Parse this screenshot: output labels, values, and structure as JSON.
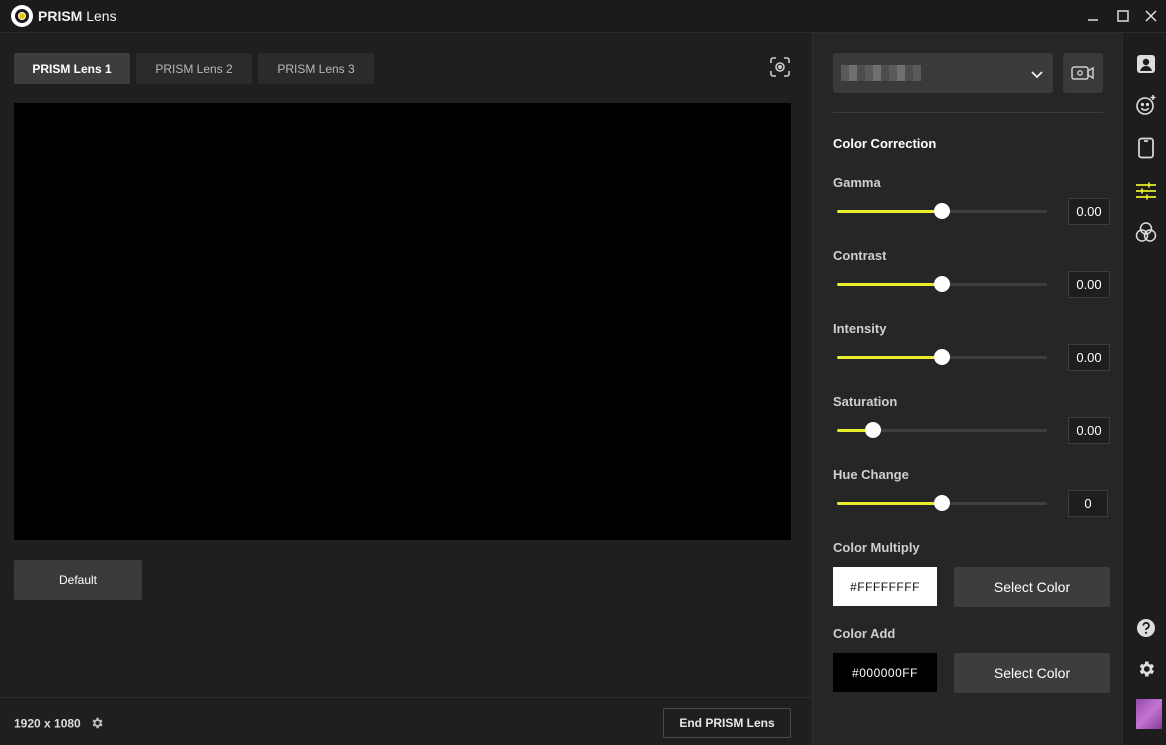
{
  "window": {
    "title_bold": "PRISM",
    "title_light": "Lens"
  },
  "tabs": [
    {
      "label": "PRISM Lens 1",
      "active": true
    },
    {
      "label": "PRISM Lens 2",
      "active": false
    },
    {
      "label": "PRISM Lens 3",
      "active": false
    }
  ],
  "preview": {
    "default_label": "Default"
  },
  "footer": {
    "resolution": "1920 x 1080",
    "end_label": "End PRISM Lens"
  },
  "panel": {
    "section_title": "Color Correction",
    "sliders": [
      {
        "label": "Gamma",
        "value": "0.00",
        "fraction": 0.5
      },
      {
        "label": "Contrast",
        "value": "0.00",
        "fraction": 0.5
      },
      {
        "label": "Intensity",
        "value": "0.00",
        "fraction": 0.5
      },
      {
        "label": "Saturation",
        "value": "0.00",
        "fraction": 0.17
      },
      {
        "label": "Hue Change",
        "value": "0",
        "fraction": 0.5
      }
    ],
    "color_multiply": {
      "label": "Color Multiply",
      "hex": "#FFFFFFFF",
      "button": "Select Color"
    },
    "color_add": {
      "label": "Color Add",
      "hex": "#000000FF",
      "button": "Select Color"
    }
  },
  "colors": {
    "accent": "#e8ee2a",
    "background": "#1f1f1f",
    "panel": "#262626"
  },
  "icons": [
    "profile-icon",
    "face-effect-icon",
    "phone-frame-icon",
    "sliders-icon",
    "color-circles-icon",
    "help-icon",
    "settings-icon",
    "screenshot-icon",
    "camera-settings-icon"
  ]
}
